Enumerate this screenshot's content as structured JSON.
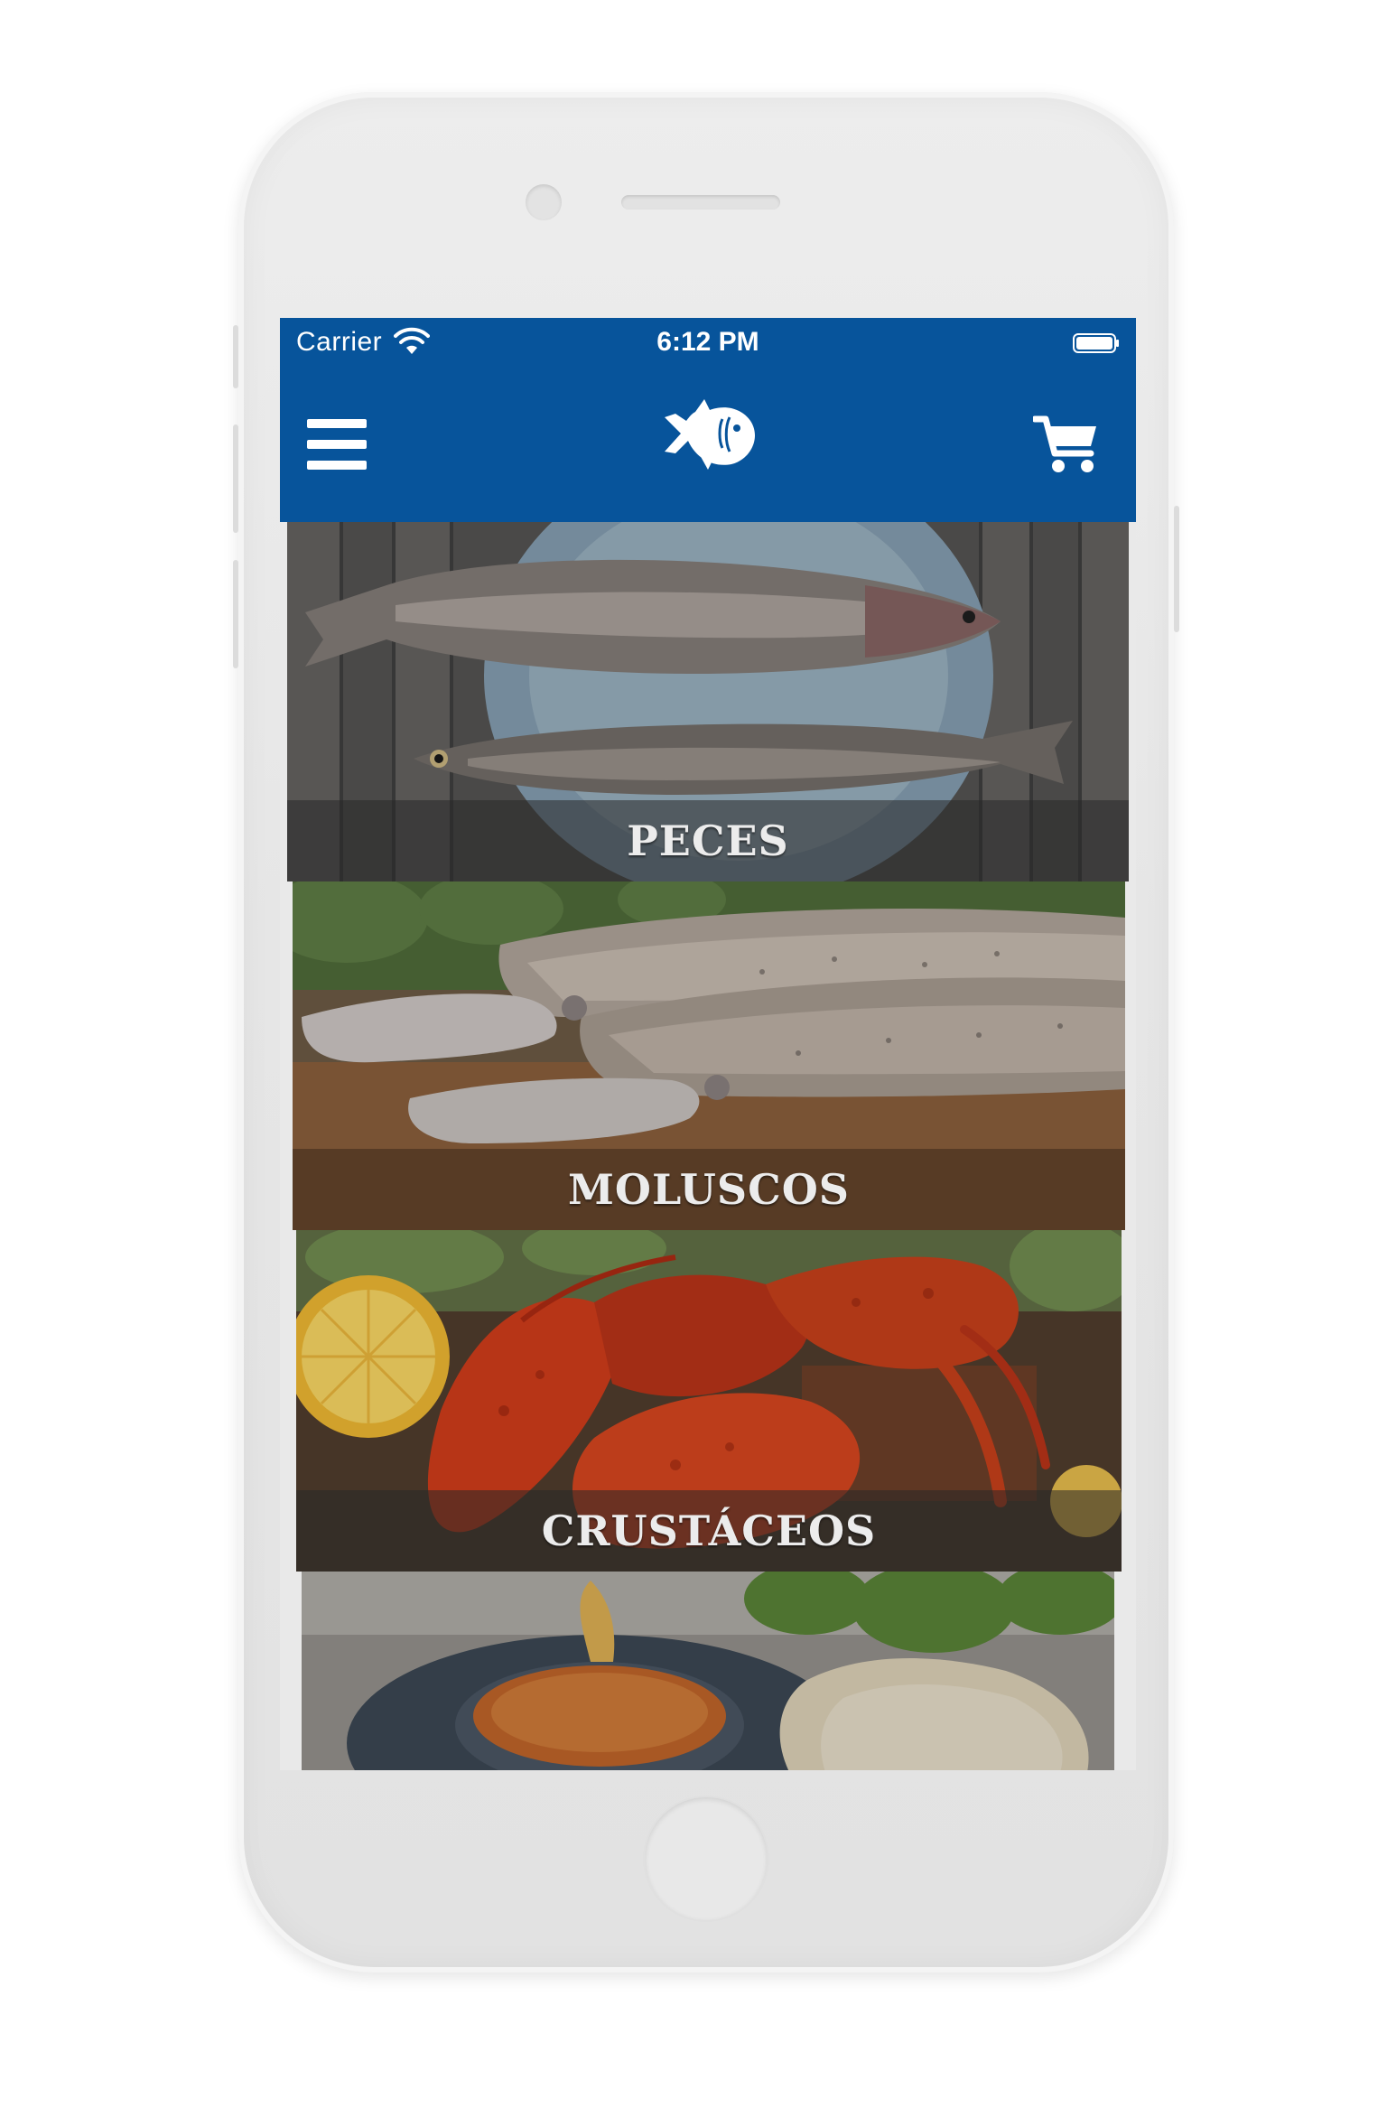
{
  "status_bar": {
    "carrier": "Carrier",
    "time": "6:12 PM",
    "wifi_icon": "wifi-icon",
    "battery_icon": "battery-icon"
  },
  "nav_bar": {
    "background_color": "#07549b",
    "menu_icon": "hamburger-menu-icon",
    "logo_icon": "fish-logo-icon",
    "cart_icon": "shopping-cart-icon"
  },
  "categories": [
    {
      "label": "PECES",
      "image": "trout-on-plate-photo"
    },
    {
      "label": "MOLUSCOS",
      "image": "squid-on-board-photo"
    },
    {
      "label": "CRUSTÁCEOS",
      "image": "lobster-with-lemon-photo"
    },
    {
      "label": "",
      "image": "seafood-with-sauce-photo"
    }
  ]
}
